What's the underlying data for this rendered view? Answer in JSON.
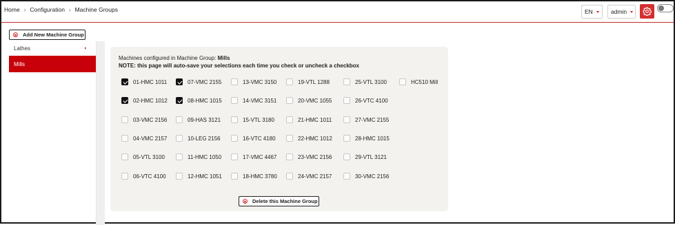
{
  "breadcrumb": [
    "Home",
    "Configuration",
    "Machine Groups"
  ],
  "header": {
    "language": "EN",
    "user": "admin",
    "settings_icon": "gear-icon",
    "toggle_state": "off",
    "accent_color": "#d32f2f"
  },
  "sidebar": {
    "add_button_label": "Add New Machine Group",
    "items": [
      {
        "label": "Lathes",
        "active": false
      },
      {
        "label": "Mills",
        "active": true
      }
    ]
  },
  "panel": {
    "title_prefix": "Machines configured in Machine Group: ",
    "group_name": "Mills",
    "note": "NOTE: this page will auto-save your selections each time you check or uncheck a checkbox",
    "delete_button_label": "Delete this Machine Group"
  },
  "machines": [
    [
      {
        "label": "01-HMC 1011",
        "checked": true
      },
      {
        "label": "07-VMC 2155",
        "checked": true
      },
      {
        "label": "13-VMC 3150",
        "checked": false
      },
      {
        "label": "19-VTL 1288",
        "checked": false
      },
      {
        "label": "25-VTL 3100",
        "checked": false
      },
      {
        "label": "HC510 Mill",
        "checked": false
      }
    ],
    [
      {
        "label": "02-HMC 1012",
        "checked": true
      },
      {
        "label": "08-HMC 1015",
        "checked": true
      },
      {
        "label": "14-VMC 3151",
        "checked": false
      },
      {
        "label": "20-VMC 1055",
        "checked": false
      },
      {
        "label": "26-VTC 4100",
        "checked": false
      }
    ],
    [
      {
        "label": "03-VMC 2156",
        "checked": false
      },
      {
        "label": "09-HAS 3121",
        "checked": false
      },
      {
        "label": "15-VTL 3180",
        "checked": false
      },
      {
        "label": "21-HMC 1011",
        "checked": false
      },
      {
        "label": "27-VMC 2155",
        "checked": false
      }
    ],
    [
      {
        "label": "04-VMC 2157",
        "checked": false
      },
      {
        "label": "10-LEG 2156",
        "checked": false
      },
      {
        "label": "16-VTC 4180",
        "checked": false
      },
      {
        "label": "22-HMC 1012",
        "checked": false
      },
      {
        "label": "28-HMC 1015",
        "checked": false
      }
    ],
    [
      {
        "label": "05-VTL 3100",
        "checked": false
      },
      {
        "label": "11-HMC 1050",
        "checked": false
      },
      {
        "label": "17-VMC 4467",
        "checked": false
      },
      {
        "label": "23-VMC 2156",
        "checked": false
      },
      {
        "label": "29-VTL 3121",
        "checked": false
      }
    ],
    [
      {
        "label": "06-VTC 4100",
        "checked": false
      },
      {
        "label": "12-HMC 1051",
        "checked": false
      },
      {
        "label": "18-HMC 3780",
        "checked": false
      },
      {
        "label": "24-VMC 2157",
        "checked": false
      },
      {
        "label": "30-VMC 2156",
        "checked": false
      }
    ]
  ]
}
